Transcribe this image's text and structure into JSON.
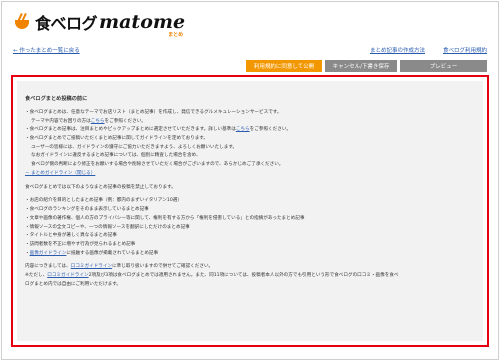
{
  "brand": {
    "name": "食べログ",
    "product": "matome",
    "tag": "まとめ"
  },
  "nav": {
    "back": "← 作ったまとめ一覧に戻る",
    "howto": "まとめ記事の作成方法",
    "terms": "食べログ利用規約"
  },
  "actions": {
    "agree_publish": "利用規約に同意して公開",
    "cancel_draft": "キャンセル/下書き保存",
    "preview": "プレビュー"
  },
  "notice": {
    "title": "食べログまとめ投稿の前に",
    "p1_a": "・食べログまとめは、任意なテーマでお店リスト（まとめ記事）を作成し、発信できるグルメキュレーションサービスです。",
    "p1_b": "テーマや内容でお困りの方は",
    "p1_link": "こちら",
    "p1_c": "をご参照ください。",
    "p2_a": "・食べログまとめ記事は、注目まとめやピックアップまとめに選定させていただきます。詳しい基準は",
    "p2_link": "こちら",
    "p2_b": "をご参照ください。",
    "p3_a": "・食べログまとめでご投稿いただくまとめ記事に関してガイドラインを定めております。",
    "p3_b": "ユーザーの皆様には、ガイドラインの遵守にご協力いただきますよう、よろしくお願いいたします。",
    "p3_c": "なおガイドラインに違反するまとめ記事については、個別に精査した場合を含め、",
    "p3_d": "食べログ側の判断により修正をお願いする場合や削除させていただく場合がございますので、あらかじめご了承ください。",
    "guide_toggle": "－ まとめガイドライン（閉じる）",
    "g_intro": "食べログまとめでは以下のようなまとめ記事の投稿を禁止しております。",
    "g1": "・お店の紹介を目的としたまとめ記事（例：都内のまずいイタリアン10選）",
    "g2": "・食べログのランキングをそのまま表示しているまとめ記事",
    "g3": "・文章や画像の著作権、個人の方のプライバシー等に関して、権利を有する方から「権利を侵害している」との指摘があったまとめ記事",
    "g4": "・情報ソースの全文コピーや、一つの情報ソースを翻訳にしただけのまとめ記事",
    "g5": "・タイトルと中身が著しく異なるまとめ記事",
    "g6": "・訪問者数を不正に増やす行為が見られるまとめ記事",
    "g7_a": "・",
    "g7_link": "画像ガイドライン",
    "g7_b": "に抵触する画像が掲載されているまとめ記事",
    "f1_a": "内容につきましては、",
    "f1_link": "口コミガイドライン",
    "f1_b": "に準じ取り扱いますので併せてご確認ください。",
    "f2_a": "※ただし、",
    "f2_link": "口コミガイドライン",
    "f2_b": "2項及び3項は食べログまとめでは適用されません。また、同11項については、投稿者本人以外の方でも引用という形で食べログの口コミ・画像を食べ",
    "f2_c": "ログまとめ内では自由にご利用いただけます。"
  }
}
